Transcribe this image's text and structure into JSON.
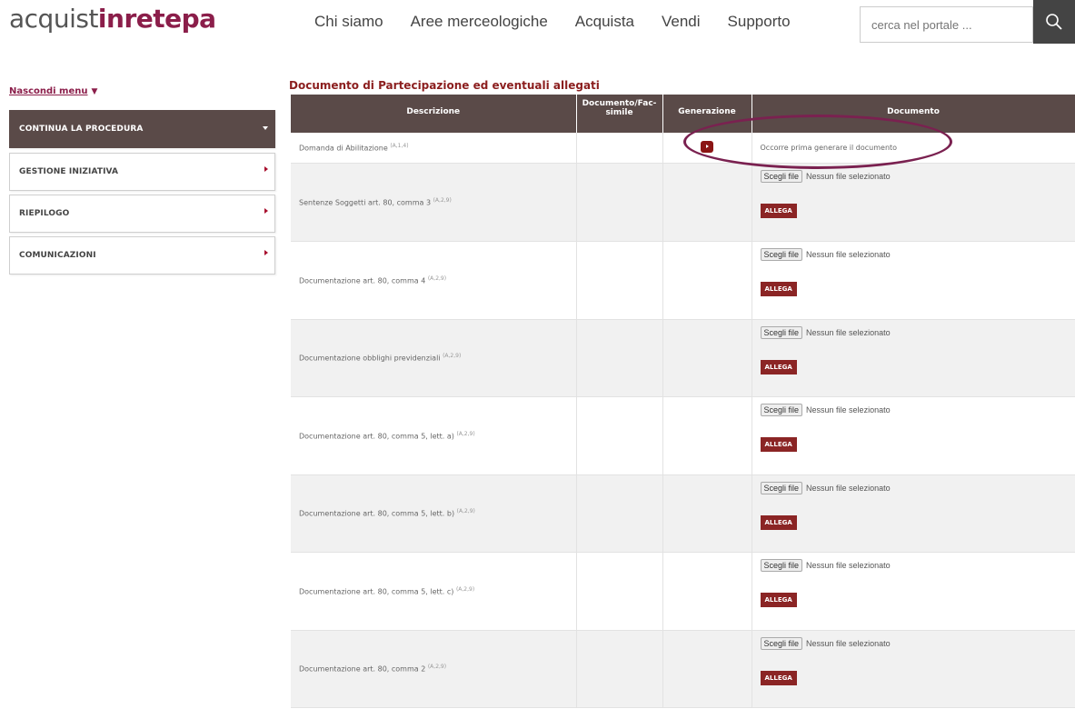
{
  "header": {
    "logo_part1": "acquist",
    "logo_part2": "in",
    "logo_part3": "rete",
    "logo_part4": "pa",
    "nav": [
      "Chi siamo",
      "Aree merceologiche",
      "Acquista",
      "Vendi",
      "Supporto"
    ],
    "search_placeholder": "cerca nel portale ..."
  },
  "sidebar": {
    "hide_label": "Nascondi menu",
    "items": [
      {
        "label": "CONTINUA LA PROCEDURA"
      },
      {
        "label": "GESTIONE INIZIATIVA"
      },
      {
        "label": "RIEPILOGO"
      },
      {
        "label": "COMUNICAZIONI"
      }
    ]
  },
  "main": {
    "title": "Documento di Partecipazione ed eventuali allegati",
    "columns": [
      "Descrizione",
      "Documento/Fac-simile",
      "Generazione",
      "Documento"
    ],
    "first_row": {
      "description": "Domanda di Abilitazione",
      "sup": "(A,1,4)",
      "message": "Occorre prima generare il documento"
    },
    "file_button": "Scegli file",
    "no_file": "Nessun file selezionato",
    "attach_button": "ALLEGA",
    "rows": [
      {
        "description": "Sentenze Soggetti art. 80, comma 3",
        "sup": "(A,2,9)"
      },
      {
        "description": "Documentazione art. 80, comma 4",
        "sup": "(A,2,9)"
      },
      {
        "description": "Documentazione obblighi previdenziali",
        "sup": "(A,2,9)"
      },
      {
        "description": "Documentazione art. 80, comma 5, lett. a)",
        "sup": "(A,2,9)"
      },
      {
        "description": "Documentazione art. 80, comma 5, lett. b)",
        "sup": "(A,2,9)"
      },
      {
        "description": "Documentazione art. 80, comma 5, lett. c)",
        "sup": "(A,2,9)"
      },
      {
        "description": "Documentazione art. 80, comma 2",
        "sup": "(A,2,9)"
      }
    ]
  },
  "colors": {
    "brand": "#8b1e4a",
    "header_bg": "#5a4a48",
    "button_red": "#8b2525"
  }
}
